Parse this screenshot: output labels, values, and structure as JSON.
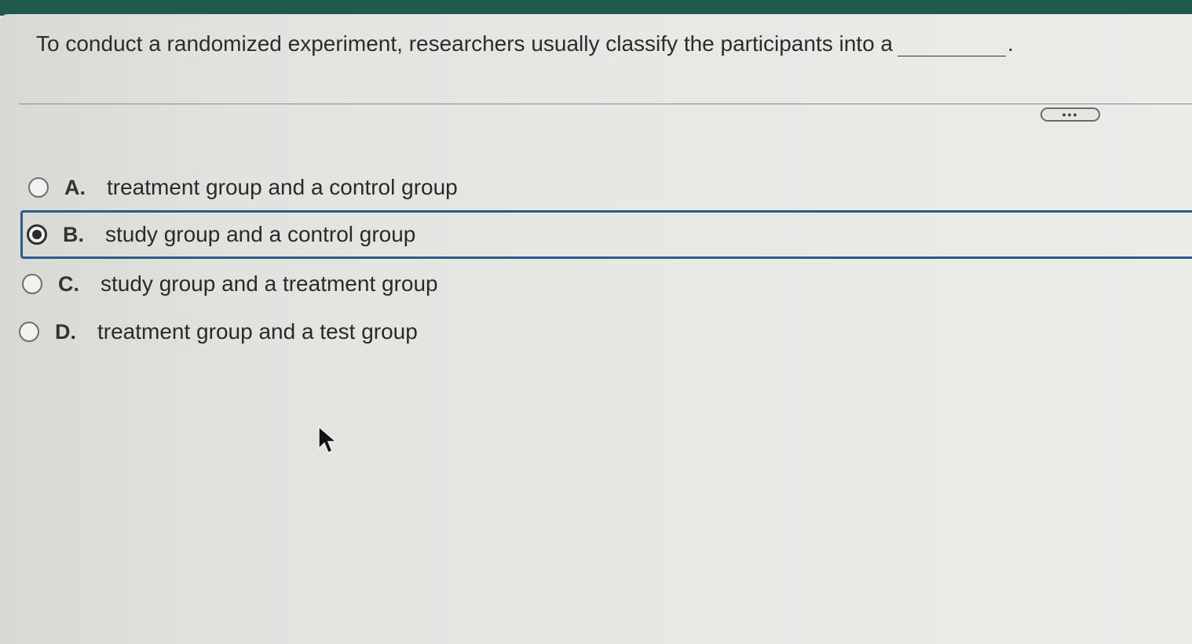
{
  "question": {
    "text": "To conduct a randomized experiment, researchers usually classify the participants into a",
    "end_mark": "."
  },
  "more_button": {
    "label": "•••"
  },
  "options": [
    {
      "letter": "A.",
      "text": "treatment group and a control group",
      "selected": false
    },
    {
      "letter": "B.",
      "text": "study group and a control group",
      "selected": true
    },
    {
      "letter": "C.",
      "text": "study group and a treatment group",
      "selected": false
    },
    {
      "letter": "D.",
      "text": "treatment group and a test group",
      "selected": false
    }
  ],
  "colors": {
    "header": "#1f5a4a",
    "selection_border": "#2e5a86"
  }
}
